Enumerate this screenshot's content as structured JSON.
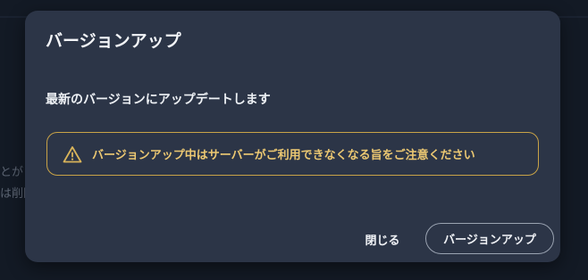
{
  "background": {
    "fragment_1": "とが",
    "fragment_2": "は削除"
  },
  "dialog": {
    "title": "バージョンアップ",
    "message": "最新のバージョンにアップデートします",
    "warning": {
      "icon": "warning-triangle-icon",
      "text": "バージョンアップ中はサーバーがご利用できなくなる旨をご注意ください"
    },
    "buttons": {
      "close_label": "閉じる",
      "upgrade_label": "バージョンアップ"
    }
  },
  "colors": {
    "dialog_bg": "#2c3547",
    "warning_accent": "#c9a347",
    "warning_text": "#ecc872"
  }
}
